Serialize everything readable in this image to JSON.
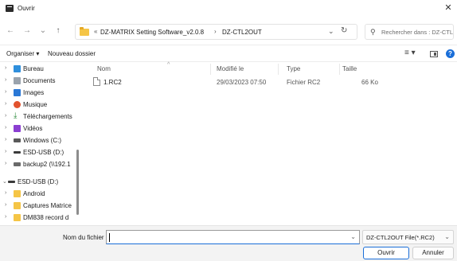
{
  "window": {
    "title": "Ouvrir",
    "close_glyph": "✕"
  },
  "nav": {
    "back_glyph": "←",
    "forward_glyph": "→",
    "recent_glyph": "⌄",
    "up_glyph": "↑",
    "breadcrumbs": [
      "«",
      "DZ-MATRIX Setting Software_v2.0.8",
      "›",
      "DZ-CTL2OUT"
    ],
    "address_dropdown_glyph": "⌄",
    "refresh_glyph": "↻",
    "search_placeholder": "Rechercher dans : DZ-CTL2O...",
    "search_glyph": "⚲"
  },
  "toolbar": {
    "organize_label": "Organiser ▾",
    "new_folder_label": "Nouveau dossier",
    "view_glyph": "≡ ▾",
    "help_glyph": "?"
  },
  "sidebar": {
    "items": [
      {
        "label": "Bureau",
        "icon": "desktop-icon",
        "color": "#2f8fdc"
      },
      {
        "label": "Documents",
        "icon": "documents-icon",
        "color": "#9aa3ad"
      },
      {
        "label": "Images",
        "icon": "images-icon",
        "color": "#2a78d6"
      },
      {
        "label": "Musique",
        "icon": "music-icon",
        "color": "#e2532e"
      },
      {
        "label": "Téléchargements",
        "icon": "download-icon",
        "color": "#2a8a3a"
      },
      {
        "label": "Vidéos",
        "icon": "videos-icon",
        "color": "#8b3fd1"
      },
      {
        "label": "Windows (C:)",
        "icon": "drive-icon",
        "color": "#5a5a5a"
      },
      {
        "label": "ESD-USB (D:)",
        "icon": "usb-drive-icon",
        "color": "#3a3a3a"
      },
      {
        "label": "backup2 (\\\\192.1",
        "icon": "network-drive-icon",
        "color": "#6a6a6a"
      }
    ],
    "root": {
      "label": "ESD-USB (D:)",
      "icon": "usb-drive-icon",
      "color": "#3a3a3a"
    },
    "root_children": [
      {
        "label": "Android",
        "icon": "folder-icon",
        "color": "#f5c546"
      },
      {
        "label": "Captures Matrice",
        "icon": "folder-icon",
        "color": "#f5c546"
      },
      {
        "label": "DM838 record d",
        "icon": "folder-icon",
        "color": "#f5c546"
      }
    ]
  },
  "filelist": {
    "columns": {
      "name": "Nom",
      "modified": "Modifié le",
      "type": "Type",
      "size": "Taille"
    },
    "sort_glyph": "^",
    "rows": [
      {
        "name": "1.RC2",
        "modified": "29/03/2023 07:50",
        "type": "Fichier RC2",
        "size": "66 Ko"
      }
    ]
  },
  "footer": {
    "filename_label": "Nom du fichier :",
    "filename_value": "",
    "filetype_value": "DZ-CTL2OUT File(*.RC2)",
    "dropdown_glyph": "⌄",
    "open_label": "Ouvrir",
    "cancel_label": "Annuler"
  },
  "colors": {
    "accent": "#1a6ed8",
    "folder": "#f5c546"
  }
}
